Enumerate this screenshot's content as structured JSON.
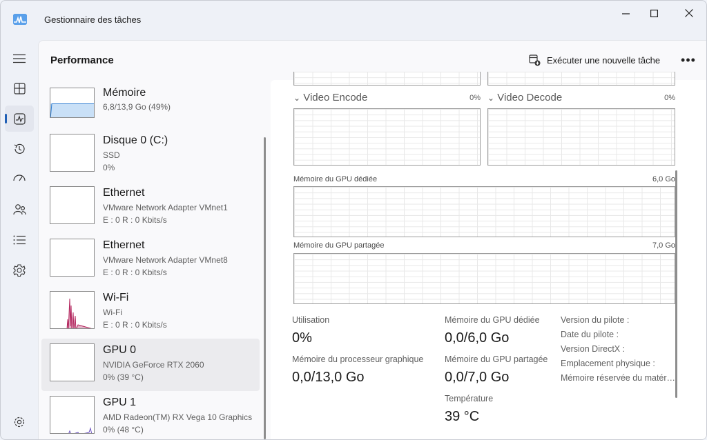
{
  "window": {
    "title": "Gestionnaire des tâches",
    "controls": {
      "minimize": "—",
      "maximize": "☐",
      "close": "✕"
    }
  },
  "nav": [
    {
      "icon": "hamburger-menu-icon"
    },
    {
      "icon": "processes-icon"
    },
    {
      "icon": "performance-icon",
      "active": true
    },
    {
      "icon": "app-history-icon"
    },
    {
      "icon": "startup-apps-icon"
    },
    {
      "icon": "users-icon"
    },
    {
      "icon": "details-icon"
    },
    {
      "icon": "services-icon"
    },
    {
      "icon": "settings-icon"
    }
  ],
  "header": {
    "title": "Performance",
    "run_task": "Exécuter une nouvelle tâche",
    "more": "•••"
  },
  "devices": [
    {
      "name": "Mémoire",
      "line1": "6,8/13,9 Go (49%)",
      "line2": "",
      "usage": 0.49
    },
    {
      "name": "Disque 0 (C:)",
      "line1": "SSD",
      "line2": "0%"
    },
    {
      "name": "Ethernet",
      "line1": "VMware Network Adapter VMnet1",
      "line2": "E : 0 R : 0 Kbits/s"
    },
    {
      "name": "Ethernet",
      "line1": "VMware Network Adapter VMnet8",
      "line2": "E : 0 R : 0 Kbits/s"
    },
    {
      "name": "Wi-Fi",
      "line1": "Wi-Fi",
      "line2": "E : 0 R : 0 Kbits/s"
    },
    {
      "name": "GPU 0",
      "line1": "NVIDIA GeForce RTX 2060",
      "line2": "0% (39 °C)",
      "selected": true
    },
    {
      "name": "GPU 1",
      "line1": "AMD Radeon(TM) RX Vega 10 Graphics",
      "line2": "0% (48 °C)"
    }
  ],
  "graphs": {
    "video_encode": {
      "label": "Video Encode",
      "pct": "0%"
    },
    "video_decode": {
      "label": "Video Decode",
      "pct": "0%"
    },
    "dedicated": {
      "label": "Mémoire du GPU dédiée",
      "max": "6,0 Go"
    },
    "shared": {
      "label": "Mémoire du GPU partagée",
      "max": "7,0 Go"
    }
  },
  "stats": {
    "utilisation": {
      "label": "Utilisation",
      "value": "0%"
    },
    "gpu_memory": {
      "label": "Mémoire du processeur graphique",
      "value": "0,0/13,0 Go"
    },
    "dedicated": {
      "label": "Mémoire du GPU dédiée",
      "value": "0,0/6,0 Go"
    },
    "shared": {
      "label": "Mémoire du GPU partagée",
      "value": "0,0/7,0 Go"
    },
    "temperature": {
      "label": "Température",
      "value": "39 °C"
    }
  },
  "info": [
    "Version du pilote :",
    "Date du pilote :",
    "Version DirectX :",
    "Emplacement physique :",
    "Mémoire réservée du matér…"
  ],
  "colors": {
    "accent": "#1f5fb5",
    "memory_fill": "#c9e0f7",
    "memory_stroke": "#2e7dd1",
    "wifi": "#b3265e"
  }
}
